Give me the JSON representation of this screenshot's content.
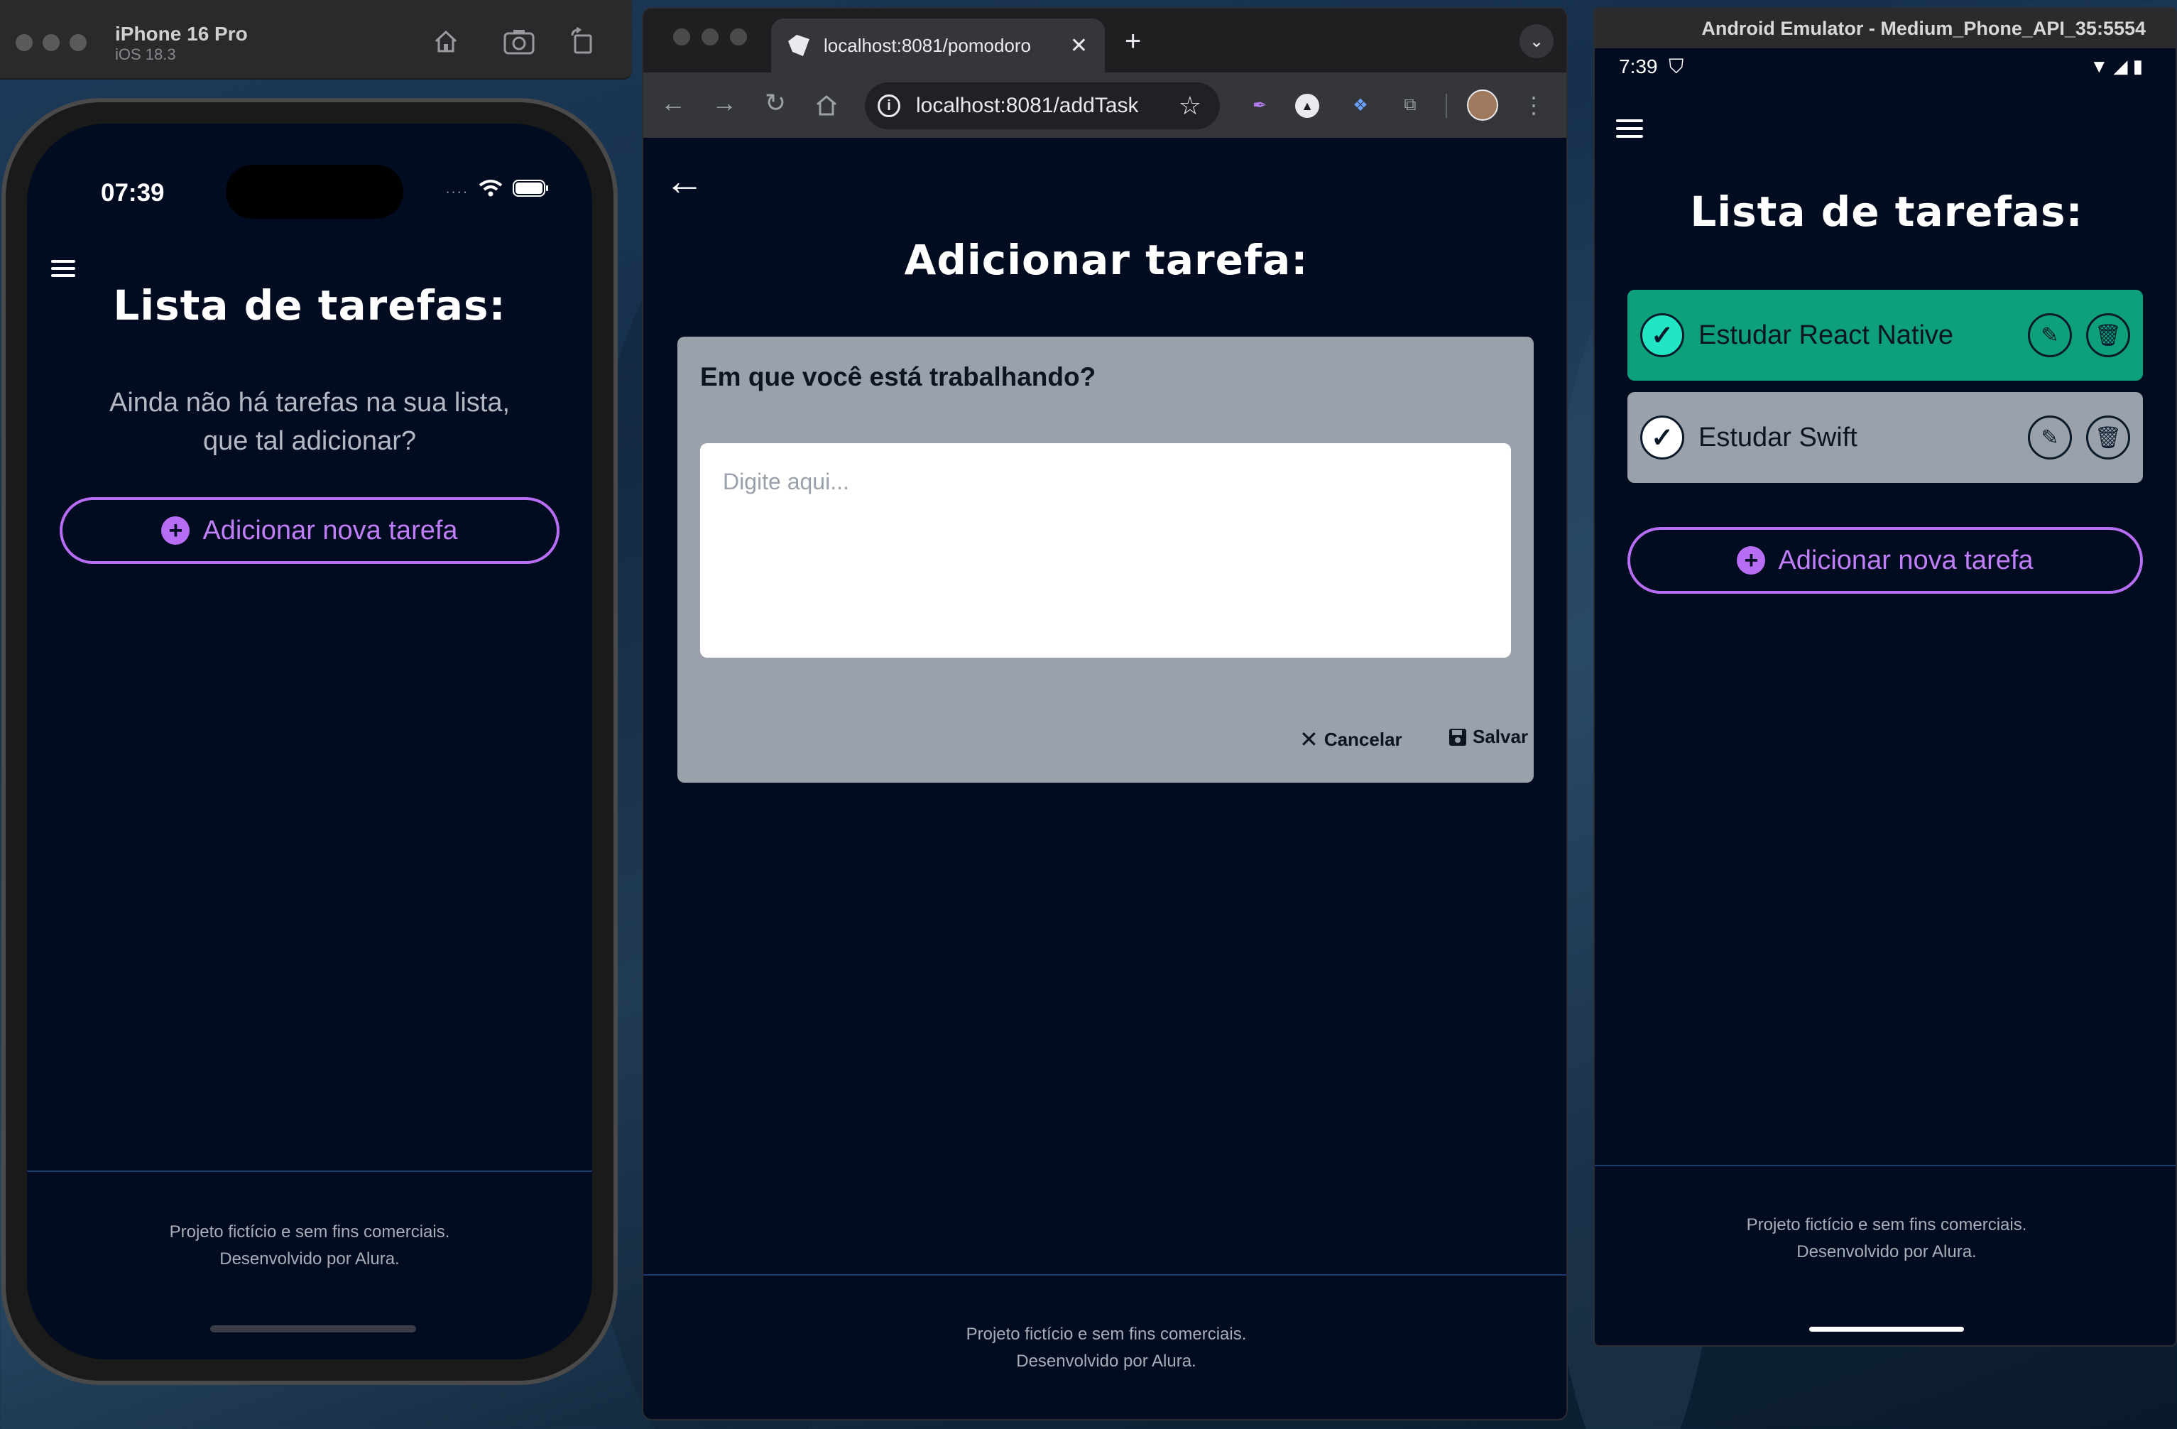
{
  "ios_sim": {
    "device_name": "iPhone 16 Pro",
    "os_version": "iOS 18.3",
    "tools": [
      "home-icon",
      "screenshot-icon",
      "rotate-icon"
    ],
    "status_time": "07:39",
    "screen_title": "Lista de tarefas:",
    "empty_message_line1": "Ainda não há tarefas na sua lista,",
    "empty_message_line2": "que tal adicionar?",
    "add_button": "Adicionar nova tarefa",
    "footer_line1": "Projeto fictício e sem fins comerciais.",
    "footer_line2": "Desenvolvido por Alura."
  },
  "browser": {
    "tab_title": "localhost:8081/pomodoro",
    "url": "localhost:8081/addTask",
    "page_title": "Adicionar tarefa:",
    "form_label": "Em que você está trabalhando?",
    "input_placeholder": "Digite aqui...",
    "input_value": "",
    "cancel_label": "Cancelar",
    "save_label": "Salvar",
    "footer_line1": "Projeto fictício e sem fins comerciais.",
    "footer_line2": "Desenvolvido por Alura."
  },
  "android": {
    "window_title": "Android Emulator - Medium_Phone_API_35:5554",
    "status_time": "7:39",
    "screen_title": "Lista de tarefas:",
    "tasks": [
      {
        "label": "Estudar React Native",
        "completed": true,
        "bg": "#0e9f7b"
      },
      {
        "label": "Estudar Swift",
        "completed": false,
        "bg": "#9aa1ab"
      }
    ],
    "add_button": "Adicionar nova tarefa",
    "footer_line1": "Projeto fictício e sem fins comerciais.",
    "footer_line2": "Desenvolvido por Alura."
  },
  "colors": {
    "app_bg": "#020c20",
    "accent_purple": "#b86df5",
    "completed_green": "#0e9f7b",
    "card_gray": "#9aa1ab"
  }
}
